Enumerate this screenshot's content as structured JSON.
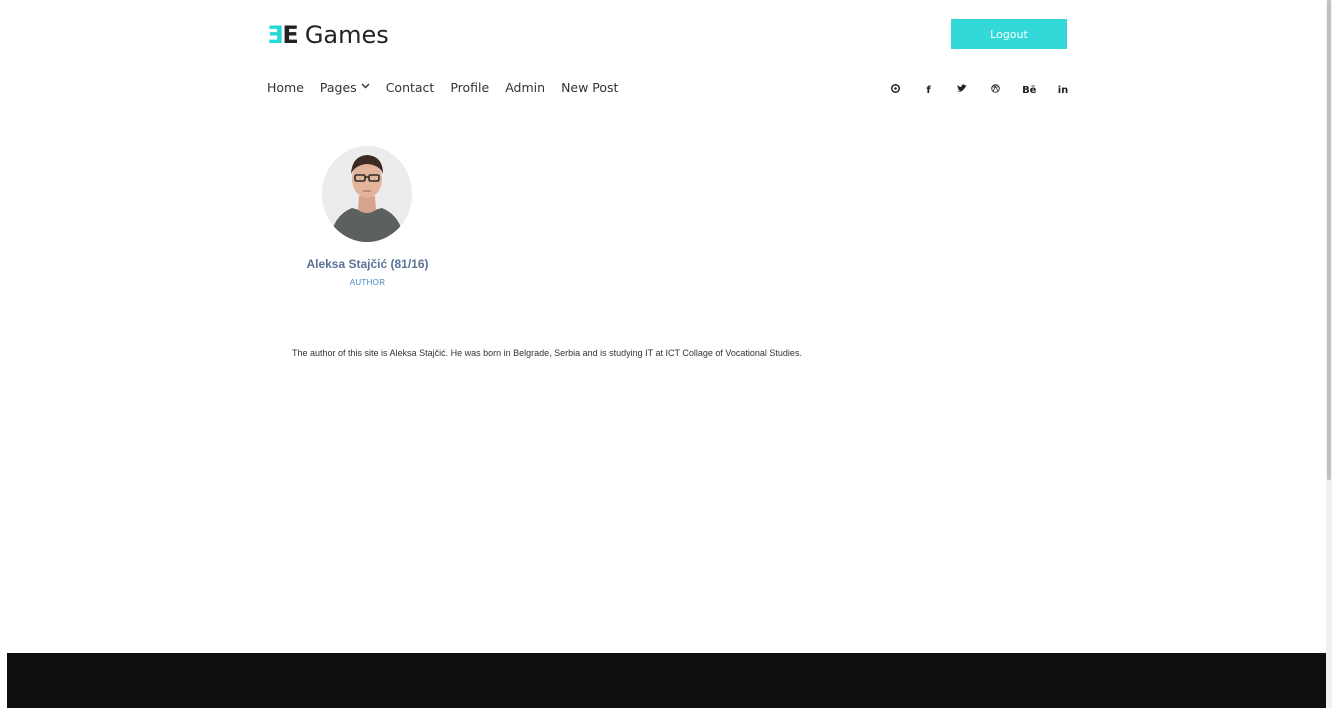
{
  "brand": {
    "mark_left": "Ǝ",
    "mark_right": "E",
    "name": "Games",
    "accent_color": "#33d8d8"
  },
  "header": {
    "logout_label": "Logout"
  },
  "nav": {
    "items": [
      {
        "label": "Home"
      },
      {
        "label": "Pages",
        "has_dropdown": true
      },
      {
        "label": "Contact"
      },
      {
        "label": "Profile"
      },
      {
        "label": "Admin"
      },
      {
        "label": "New Post"
      }
    ],
    "dropdown_icon": "chevron-down-icon"
  },
  "social": [
    {
      "icon": "pinterest-icon",
      "glyph": "℗"
    },
    {
      "icon": "facebook-icon",
      "glyph": "f"
    },
    {
      "icon": "twitter-icon",
      "glyph": "♥"
    },
    {
      "icon": "dribbble-icon",
      "glyph": "◎"
    },
    {
      "icon": "behance-icon",
      "glyph": "Bē"
    },
    {
      "icon": "linkedin-icon",
      "glyph": "in"
    }
  ],
  "profile": {
    "name": "Aleksa Stajčić (81/16)",
    "role": "AUTHOR",
    "bio": "The author of this site is Aleksa Stajčić. He was born in Belgrade, Serbia and is studying IT at ICT Collage of Vocational Studies."
  },
  "colors": {
    "footer": "#0f0f0f",
    "name_text": "#5a7396",
    "role_text": "#4a86c5"
  }
}
